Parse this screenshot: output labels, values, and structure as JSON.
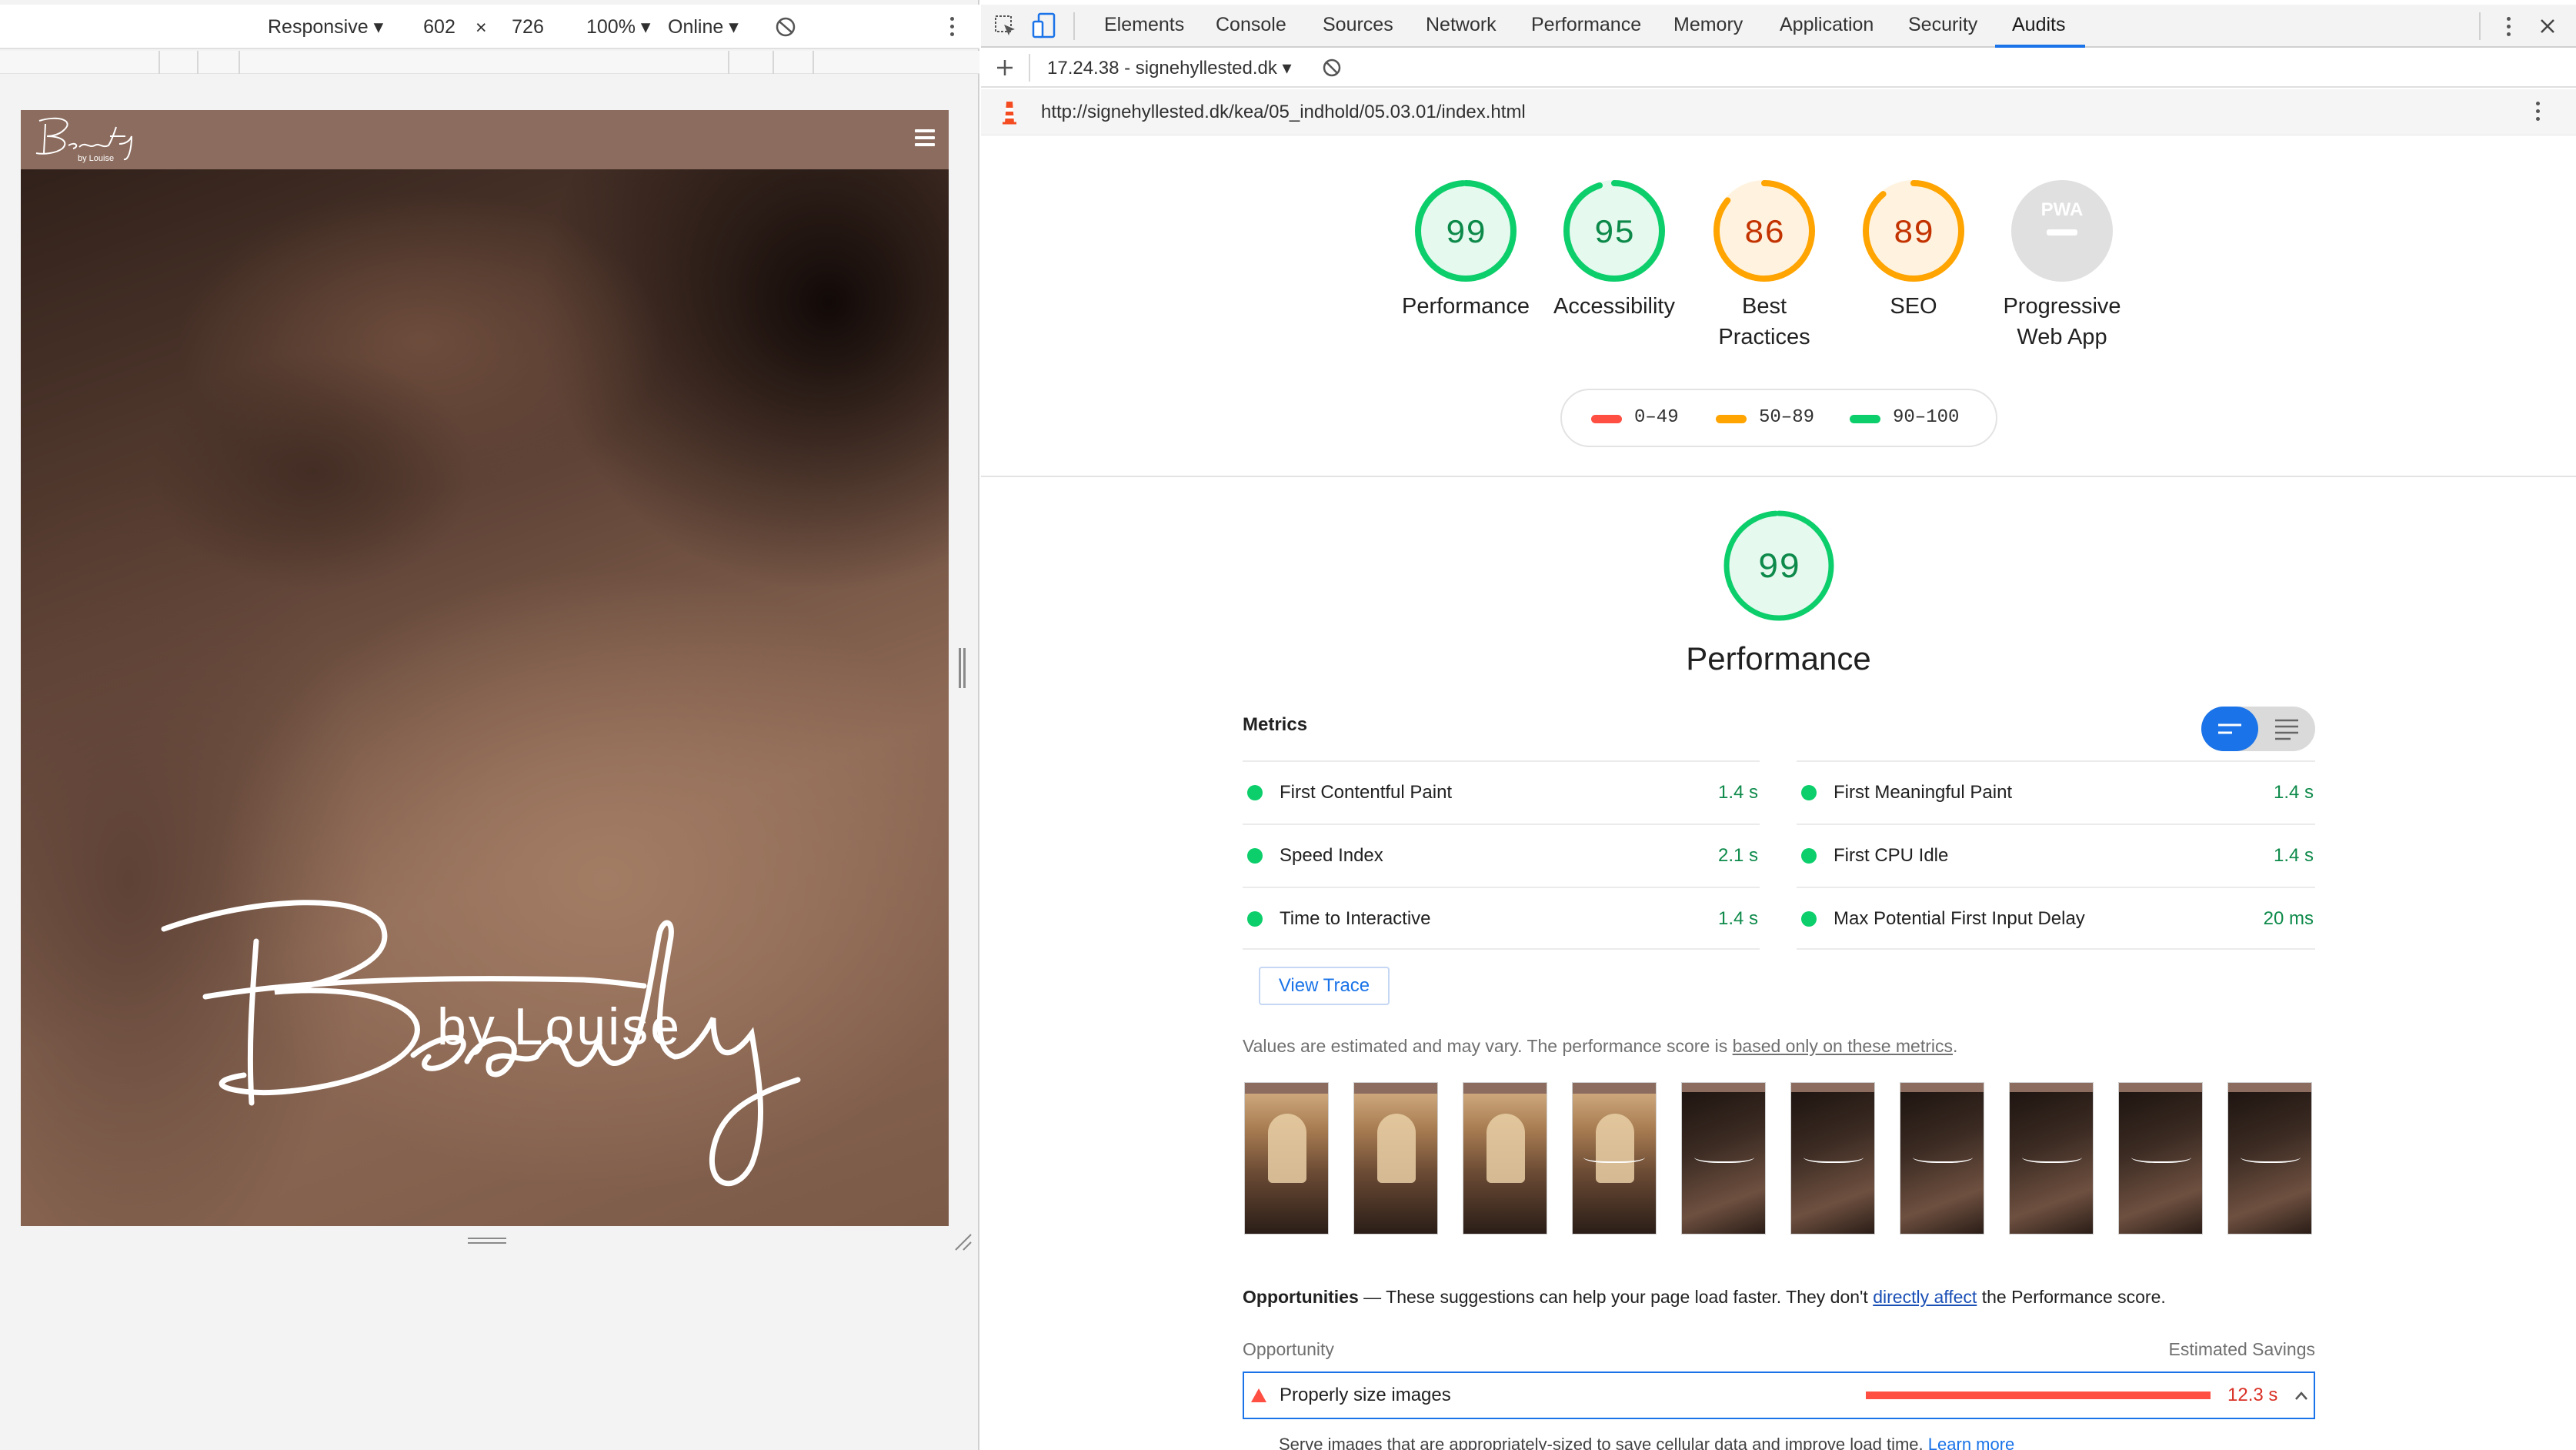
{
  "device_toolbar": {
    "device": "Responsive",
    "width": "602",
    "times": "×",
    "height": "726",
    "zoom": "100%",
    "network": "Online"
  },
  "site": {
    "logo_text": "Beauty",
    "logo_subtext": "by Louise",
    "hero_title": "Beauty",
    "hero_subtitle": "by Louise"
  },
  "devtools": {
    "tabs": [
      "Elements",
      "Console",
      "Sources",
      "Network",
      "Performance",
      "Memory",
      "Application",
      "Security",
      "Audits"
    ],
    "active_tab": "Audits",
    "report_selector": "17.24.38 - signehyllested.dk",
    "url": "http://signehyllested.dk/kea/05_indhold/05.03.01/index.html"
  },
  "scores": [
    {
      "value": "99",
      "label": "Performance",
      "status": "pass"
    },
    {
      "value": "95",
      "label": "Accessibility",
      "status": "pass"
    },
    {
      "value": "86",
      "label": "Best Practices",
      "status": "average"
    },
    {
      "value": "89",
      "label": "SEO",
      "status": "average"
    },
    {
      "value": "PWA",
      "label": "Progressive Web App",
      "status": "na"
    }
  ],
  "legend": {
    "fail": "0–49",
    "average": "50–89",
    "pass": "90–100"
  },
  "colors": {
    "pass": "#0cce6b",
    "average": "#ffa400",
    "fail": "#ff4e42",
    "na": "#e0e0e0",
    "accent": "#1a73e8"
  },
  "performance": {
    "score": "99",
    "title": "Performance",
    "metrics_heading": "Metrics",
    "metrics": [
      {
        "name": "First Contentful Paint",
        "value": "1.4 s"
      },
      {
        "name": "First Meaningful Paint",
        "value": "1.4 s"
      },
      {
        "name": "Speed Index",
        "value": "2.1 s"
      },
      {
        "name": "First CPU Idle",
        "value": "1.4 s"
      },
      {
        "name": "Time to Interactive",
        "value": "1.4 s"
      },
      {
        "name": "Max Potential First Input Delay",
        "value": "20 ms"
      }
    ],
    "view_trace": "View Trace",
    "estimated_text": "Values are estimated and may vary. The performance score is ",
    "estimated_link": "based only on these metrics",
    "estimated_end": ".",
    "filmstrip_count": 10
  },
  "opportunities": {
    "heading": "Opportunities",
    "dash": "—",
    "desc_start": "These suggestions can help your page load faster. They don't ",
    "desc_link": "directly affect",
    "desc_end": " the Performance score.",
    "col_left": "Opportunity",
    "col_right": "Estimated Savings",
    "items": [
      {
        "title": "Properly size images",
        "savings": "12.3 s",
        "bar_fraction": 1.0
      }
    ],
    "item_desc": "Serve images that are appropriately-sized to save cellular data and improve load time.",
    "item_desc_link": "Learn more"
  }
}
